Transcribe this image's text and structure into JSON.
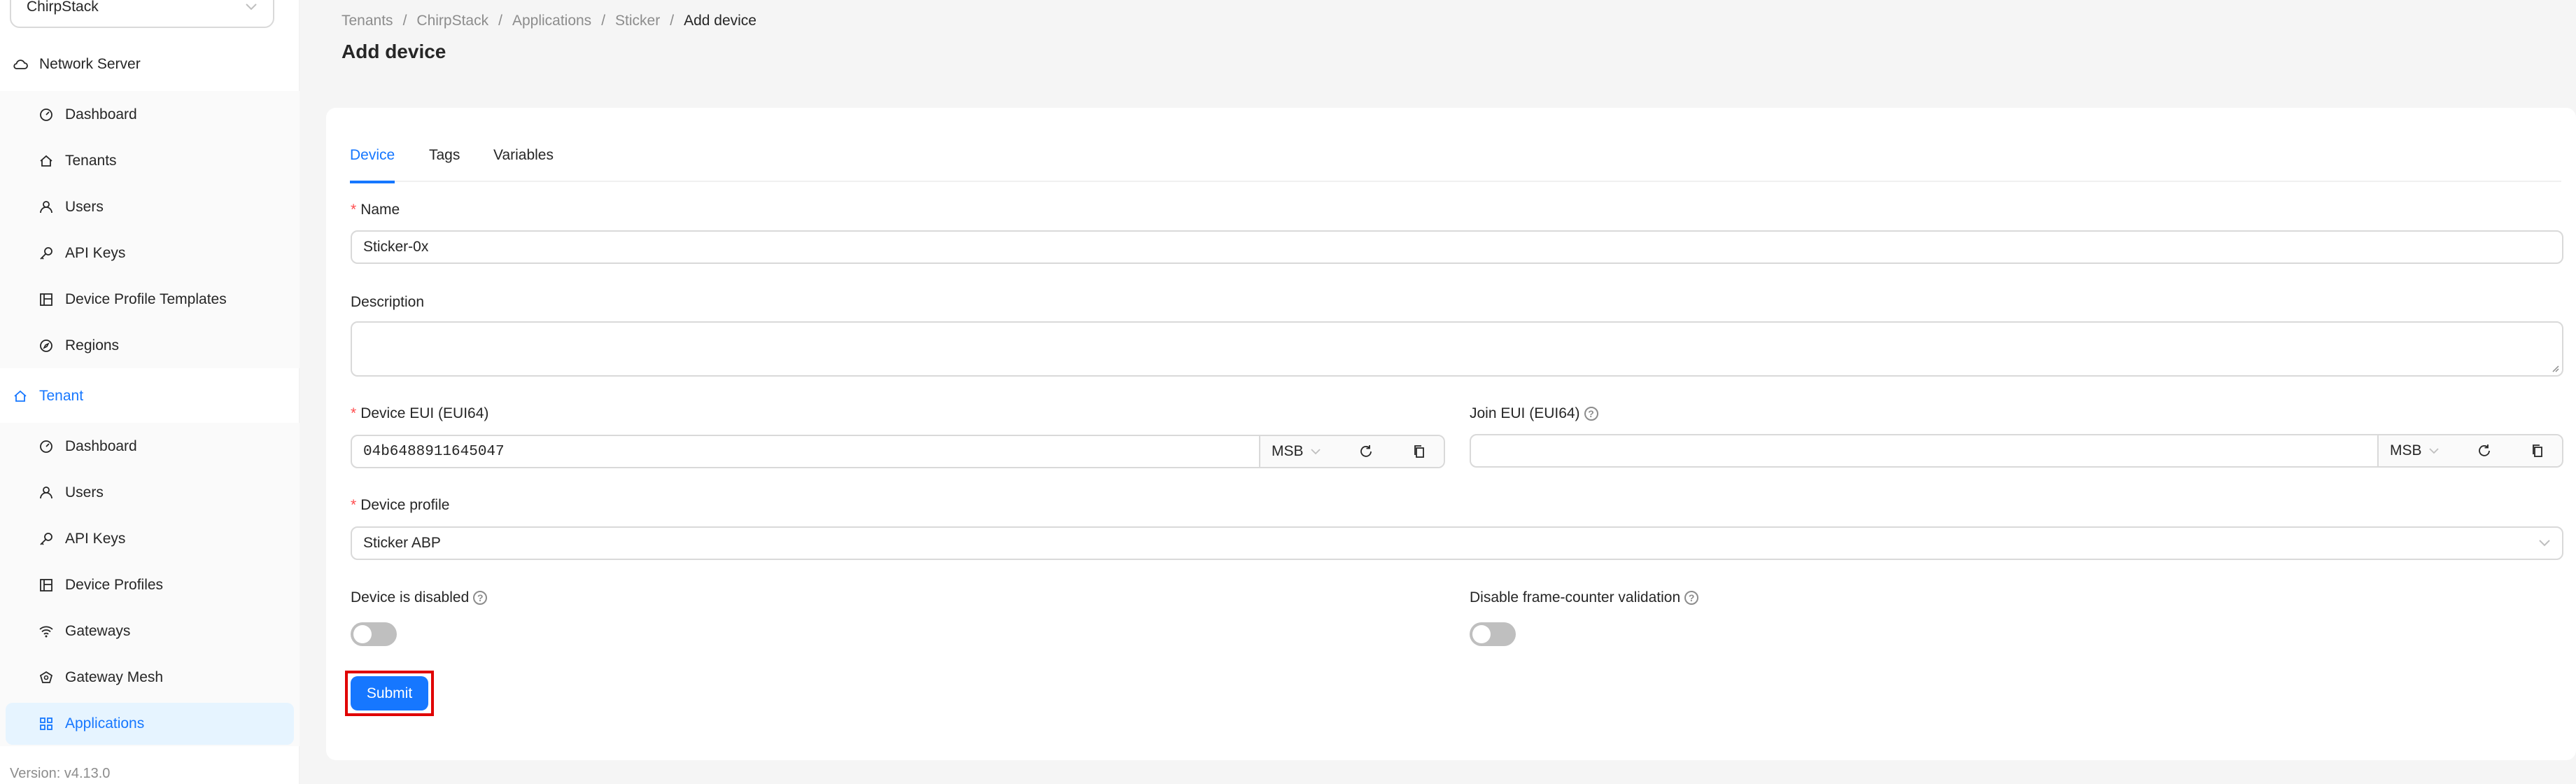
{
  "sidebar": {
    "tenant_select": "ChirpStack",
    "network_server_label": "Network Server",
    "ns_items": [
      {
        "label": "Dashboard",
        "icon": "dashboard-icon"
      },
      {
        "label": "Tenants",
        "icon": "home-icon"
      },
      {
        "label": "Users",
        "icon": "user-icon"
      },
      {
        "label": "API Keys",
        "icon": "key-icon"
      },
      {
        "label": "Device Profile Templates",
        "icon": "template-icon"
      },
      {
        "label": "Regions",
        "icon": "compass-icon"
      }
    ],
    "tenant_label": "Tenant",
    "tenant_items": [
      {
        "label": "Dashboard",
        "icon": "dashboard-icon"
      },
      {
        "label": "Users",
        "icon": "user-icon"
      },
      {
        "label": "API Keys",
        "icon": "key-icon"
      },
      {
        "label": "Device Profiles",
        "icon": "template-icon"
      },
      {
        "label": "Gateways",
        "icon": "wifi-icon"
      },
      {
        "label": "Gateway Mesh",
        "icon": "mesh-icon"
      },
      {
        "label": "Applications",
        "icon": "appstore-icon"
      }
    ],
    "version": "Version: v4.13.0"
  },
  "breadcrumb": [
    "Tenants",
    "ChirpStack",
    "Applications",
    "Sticker",
    "Add device"
  ],
  "page_title": "Add device",
  "tabs": [
    "Device",
    "Tags",
    "Variables"
  ],
  "form": {
    "name_label": "Name",
    "name_value": "Sticker-0x",
    "description_label": "Description",
    "description_value": "",
    "dev_eui_label": "Device EUI (EUI64)",
    "dev_eui_value": "04b6488911645047",
    "dev_eui_byte_order": "MSB",
    "join_eui_label": "Join EUI (EUI64)",
    "join_eui_value": "",
    "join_eui_byte_order": "MSB",
    "device_profile_label": "Device profile",
    "device_profile_value": "Sticker ABP",
    "device_disabled_label": "Device is disabled",
    "device_disabled": false,
    "disable_fcnt_label": "Disable frame-counter validation",
    "disable_fcnt": false,
    "submit_label": "Submit"
  },
  "colors": {
    "accent": "#1677ff",
    "required": "#ff4d4f",
    "highlight": "#e00000"
  }
}
